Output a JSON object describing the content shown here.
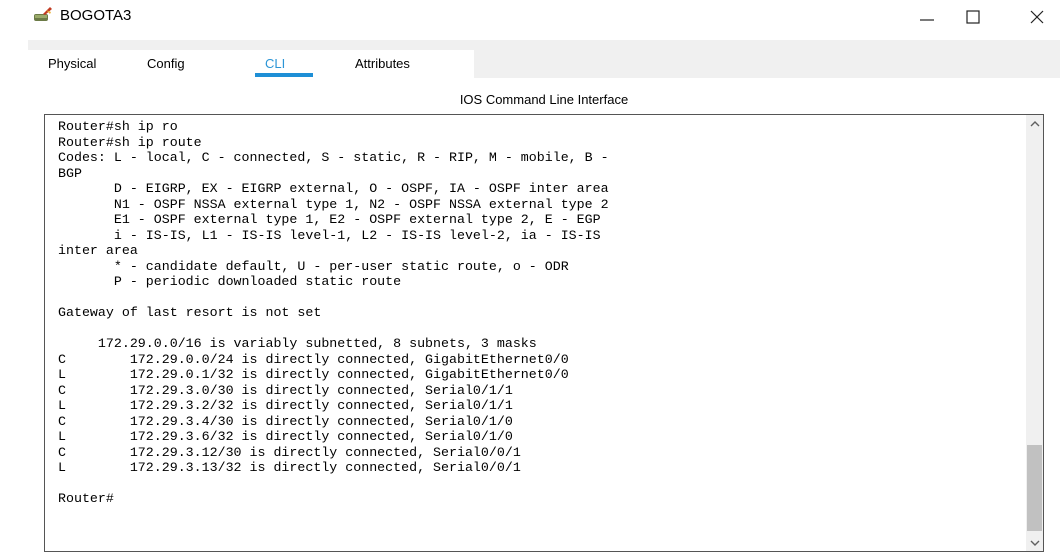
{
  "window": {
    "title": "BOGOTA3",
    "icon": "router-icon"
  },
  "tabs": [
    {
      "label": "Physical"
    },
    {
      "label": "Config"
    },
    {
      "label": "CLI"
    },
    {
      "label": "Attributes"
    }
  ],
  "active_tab": "CLI",
  "accent_color": "#1e8fd6",
  "panel": {
    "title": "IOS Command Line Interface"
  },
  "terminal": {
    "lines": [
      "Router#sh ip ro",
      "Router#sh ip route",
      "Codes: L - local, C - connected, S - static, R - RIP, M - mobile, B -",
      "BGP",
      "       D - EIGRP, EX - EIGRP external, O - OSPF, IA - OSPF inter area",
      "       N1 - OSPF NSSA external type 1, N2 - OSPF NSSA external type 2",
      "       E1 - OSPF external type 1, E2 - OSPF external type 2, E - EGP",
      "       i - IS-IS, L1 - IS-IS level-1, L2 - IS-IS level-2, ia - IS-IS",
      "inter area",
      "       * - candidate default, U - per-user static route, o - ODR",
      "       P - periodic downloaded static route",
      "",
      "Gateway of last resort is not set",
      "",
      "     172.29.0.0/16 is variably subnetted, 8 subnets, 3 masks",
      "C        172.29.0.0/24 is directly connected, GigabitEthernet0/0",
      "L        172.29.0.1/32 is directly connected, GigabitEthernet0/0",
      "C        172.29.3.0/30 is directly connected, Serial0/1/1",
      "L        172.29.3.2/32 is directly connected, Serial0/1/1",
      "C        172.29.3.4/30 is directly connected, Serial0/1/0",
      "L        172.29.3.6/32 is directly connected, Serial0/1/0",
      "C        172.29.3.12/30 is directly connected, Serial0/0/1",
      "L        172.29.3.13/32 is directly connected, Serial0/0/1",
      "",
      "Router#"
    ]
  }
}
